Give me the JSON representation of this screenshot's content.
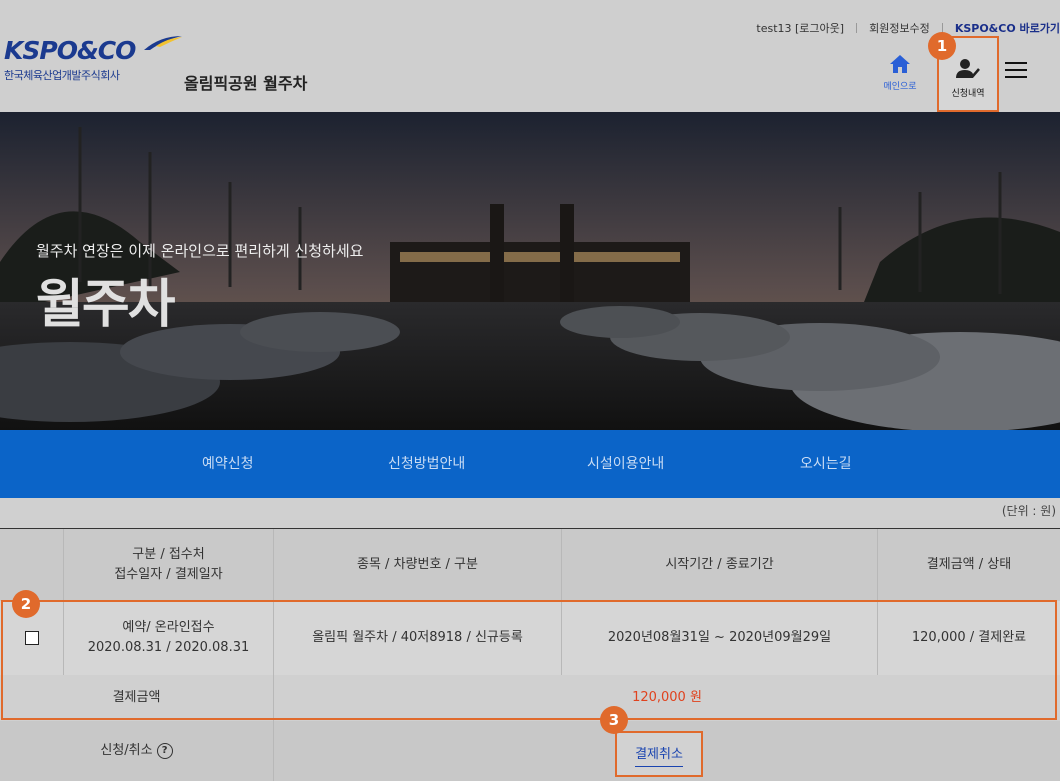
{
  "header": {
    "util_links": [
      "test13 [로그아웃]",
      "회원정보수정",
      "KSPO&CO 바로가기"
    ],
    "logo_text": "KSPO&CO",
    "logo_subtext": "한국체육산업개발주식회사",
    "site_title": "올림픽공원 월주차",
    "home_label": "메인으로",
    "history_label": "신청내역"
  },
  "markers": [
    "1",
    "2",
    "3"
  ],
  "hero": {
    "subtitle": "월주차 연장은 이제 온라인으로 편리하게 신청하세요",
    "title": "월주차"
  },
  "nav": {
    "items": [
      "예약신청",
      "신청방법안내",
      "시설이용안내",
      "오시는길"
    ]
  },
  "table": {
    "unit": "(단위 : 원)",
    "headers": [
      "",
      "구분 / 접수처\n접수일자 / 결제일자",
      "종목 / 차량번호 / 구분",
      "시작기간 / 종료기간",
      "결제금액 / 상태"
    ],
    "header_col1_line1": "구분 / 접수처",
    "header_col1_line2": "접수일자 / 결제일자",
    "row": {
      "type_line1": "예약/ 온라인접수",
      "type_line2": "2020.08.31 / 2020.08.31",
      "item": "올림픽 월주차 / 40저8918 / 신규등록",
      "period": "2020년08월31일 ~ 2020년09월29일",
      "amount_status": "120,000 / 결제완료"
    },
    "payment_label": "결제금액",
    "payment_value": "120,000 원",
    "cancel_label": "신청/취소",
    "help_icon": "?",
    "cancel_button": "결제취소"
  },
  "colors": {
    "accent": "#e06a2c",
    "nav_blue": "#0b64c8",
    "brand_navy": "#1b3a8f",
    "amount_red": "#e0421e"
  }
}
